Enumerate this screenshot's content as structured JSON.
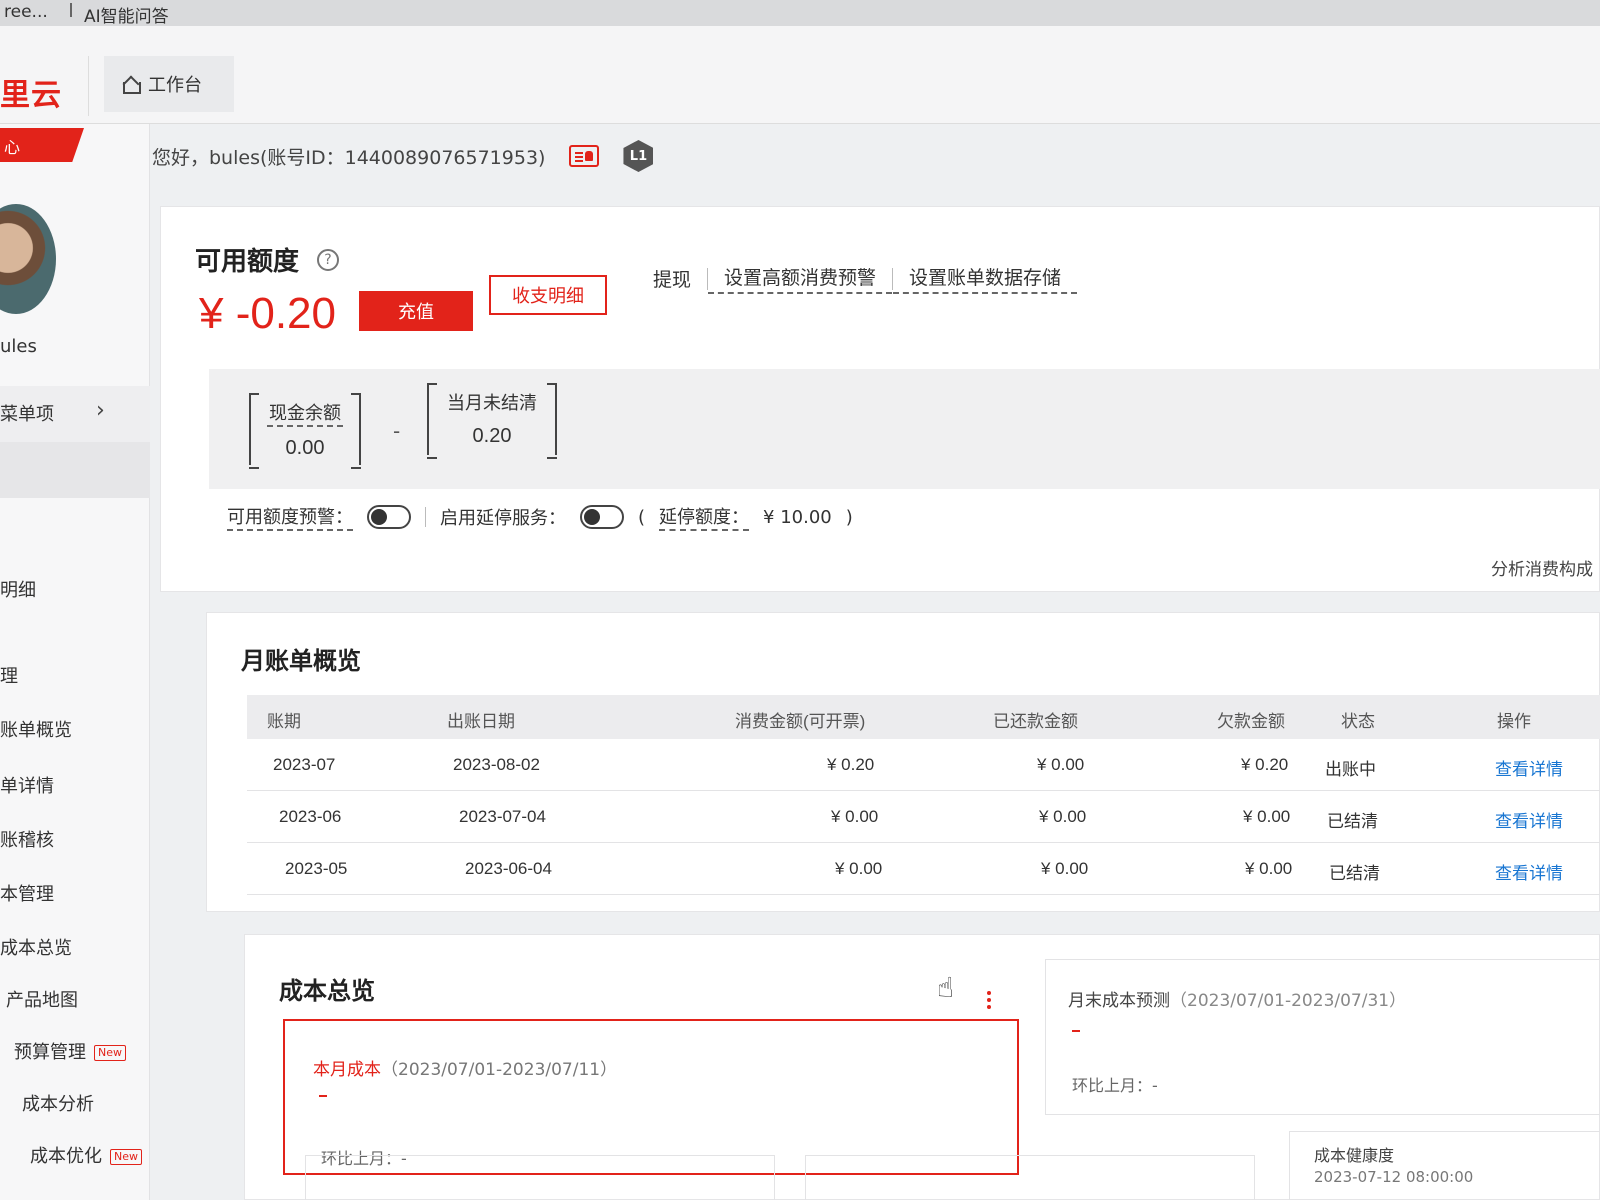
{
  "browser": {
    "tab_left": "ree...",
    "tab_right": "AI智能问答"
  },
  "topbar": {
    "logo": "里云",
    "workbench_label": "工作台"
  },
  "sidebar": {
    "flag": "心",
    "user": "ules",
    "menu_label": "菜单项",
    "items": [
      {
        "label": "明细"
      },
      {
        "label": "理"
      },
      {
        "label": "账单概览"
      },
      {
        "label": "单详情"
      },
      {
        "label": "账稽核"
      },
      {
        "label": "本管理"
      },
      {
        "label": "成本总览"
      },
      {
        "label": "产品地图"
      },
      {
        "label": "预算管理",
        "badge": "New"
      },
      {
        "label": "成本分析"
      },
      {
        "label": "成本优化",
        "badge": "New"
      }
    ]
  },
  "greeting": {
    "text": "您好，bules(账号ID：1440089076571953)",
    "level": "L1"
  },
  "quota": {
    "title": "可用额度",
    "help": "?",
    "balance": "¥ -0.20",
    "recharge": "充值",
    "details": "收支明细",
    "links": [
      "提现",
      "设置高额消费预警",
      "设置账单数据存储"
    ],
    "cash_label": "现金余额",
    "cash_value": "0.00",
    "minus": "-",
    "unsettled_label": "当月未结清",
    "unsettled_value": "0.20",
    "alert_label": "可用额度预警：",
    "delay_label": "启用延停服务：",
    "delay_open": "(",
    "delay_quota_label": "延停额度：",
    "delay_quota_value": "¥ 10.00",
    "delay_close": ")",
    "analyze": "分析消费构成"
  },
  "monthly": {
    "title": "月账单概览",
    "headers": [
      "账期",
      "出账日期",
      "消费金额(可开票)",
      "已还款金额",
      "欠款金额",
      "状态",
      "操作"
    ],
    "rows": [
      {
        "period": "2023-07",
        "date": "2023-08-02",
        "consumption": "¥ 0.20",
        "repaid": "¥ 0.00",
        "debt": "¥ 0.20",
        "status": "出账中",
        "action": "查看详情"
      },
      {
        "period": "2023-06",
        "date": "2023-07-04",
        "consumption": "¥ 0.00",
        "repaid": "¥ 0.00",
        "debt": "¥ 0.00",
        "status": "已结清",
        "action": "查看详情"
      },
      {
        "period": "2023-05",
        "date": "2023-06-04",
        "consumption": "¥ 0.00",
        "repaid": "¥ 0.00",
        "debt": "¥ 0.00",
        "status": "已结清",
        "action": "查看详情"
      }
    ]
  },
  "cost": {
    "title": "成本总览",
    "current_label": "本月成本",
    "current_range": "（2023/07/01-2023/07/11）",
    "mom_label": "环比上月：-",
    "forecast_label": "月末成本预测",
    "forecast_range": "（2023/07/01-2023/07/31）",
    "forecast_mom": "环比上月：-",
    "health_label": "成本健康度",
    "health_time": "2023-07-12 08:00:00"
  },
  "colors": {
    "accent": "#e2231a",
    "link": "#1976d2"
  }
}
